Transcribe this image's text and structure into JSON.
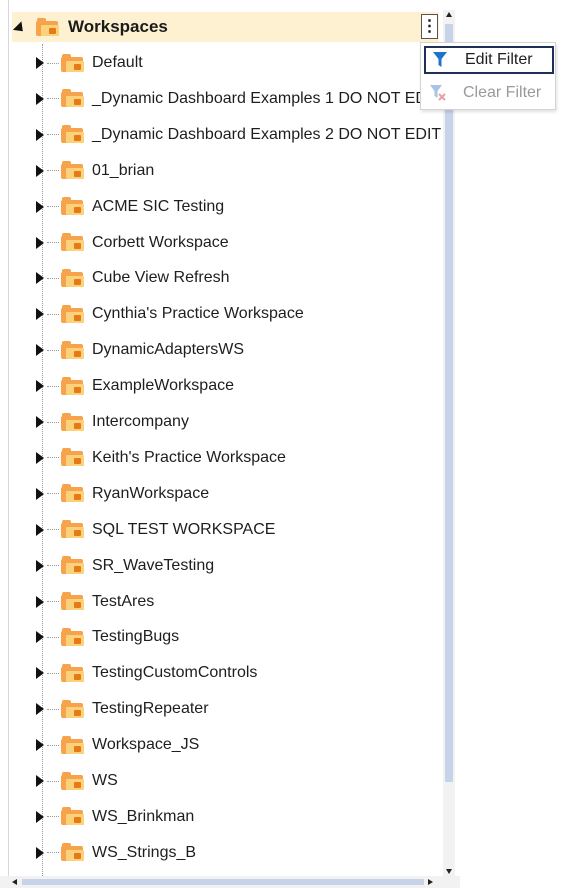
{
  "tree": {
    "root_label": "Workspaces",
    "items": [
      {
        "label": "Default"
      },
      {
        "label": "_Dynamic Dashboard Examples 1 DO NOT EDIT"
      },
      {
        "label": "_Dynamic Dashboard Examples 2 DO NOT EDIT"
      },
      {
        "label": "01_brian"
      },
      {
        "label": "ACME SIC Testing"
      },
      {
        "label": "Corbett Workspace"
      },
      {
        "label": "Cube View Refresh"
      },
      {
        "label": "Cynthia's Practice Workspace"
      },
      {
        "label": "DynamicAdaptersWS"
      },
      {
        "label": "ExampleWorkspace"
      },
      {
        "label": "Intercompany"
      },
      {
        "label": "Keith's Practice Workspace"
      },
      {
        "label": "RyanWorkspace"
      },
      {
        "label": "SQL TEST WORKSPACE"
      },
      {
        "label": "SR_WaveTesting"
      },
      {
        "label": "TestAres"
      },
      {
        "label": "TestingBugs"
      },
      {
        "label": "TestingCustomControls"
      },
      {
        "label": "TestingRepeater"
      },
      {
        "label": "Workspace_JS"
      },
      {
        "label": "WS"
      },
      {
        "label": "WS_Brinkman"
      },
      {
        "label": "WS_Strings_B"
      }
    ]
  },
  "menu": {
    "edit_filter": "Edit Filter",
    "clear_filter": "Clear Filter"
  },
  "icons": {
    "folder": "workspace-folder-icon",
    "kebab": "more-options-icon",
    "filter": "filter-icon",
    "clear_filter": "clear-filter-icon"
  },
  "colors": {
    "root_highlight": "#fdf1d2",
    "folder_orange": "#f6a34b",
    "folder_light": "#fbd17b",
    "filter_blue": "#1f73c9",
    "menu_focus_border": "#1f2f56",
    "scroll_thumb": "#c6d3e8"
  }
}
